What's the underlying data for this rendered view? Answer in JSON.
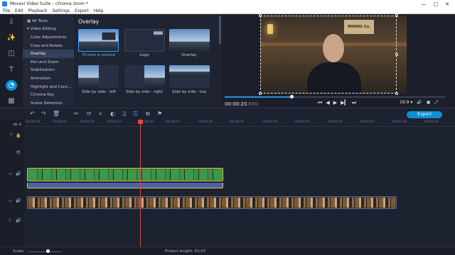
{
  "window": {
    "title": "Movavi Video Suite – chroma zoom *",
    "min": "—",
    "max": "□",
    "close": "✕"
  },
  "menu": [
    "File",
    "Edit",
    "Playback",
    "Settings",
    "Export",
    "Help"
  ],
  "left_rail": [
    {
      "icon": "import-icon",
      "glyph": "⇩"
    },
    {
      "icon": "magic-wand-icon",
      "glyph": "✨"
    },
    {
      "icon": "transitions-icon",
      "glyph": "◫"
    },
    {
      "icon": "titles-icon",
      "glyph": "T"
    },
    {
      "icon": "stickers-icon",
      "glyph": "◔"
    },
    {
      "icon": "more-tools-icon",
      "glyph": "▦"
    }
  ],
  "tools": {
    "items": [
      {
        "label": "All Tools",
        "sub": false
      },
      {
        "label": "Video Editing",
        "sub": false
      },
      {
        "label": "Color Adjustments",
        "sub": true
      },
      {
        "label": "Crop and Rotate",
        "sub": true
      },
      {
        "label": "Overlay",
        "sub": true,
        "selected": true
      },
      {
        "label": "Pan and Zoom",
        "sub": true
      },
      {
        "label": "Stabilization",
        "sub": true
      },
      {
        "label": "Animation",
        "sub": true
      },
      {
        "label": "Highlight and Conc...",
        "sub": true
      },
      {
        "label": "Chroma Key",
        "sub": true
      },
      {
        "label": "Scene Detection",
        "sub": true
      }
    ]
  },
  "overlay_panel": {
    "title": "Overlay",
    "options": [
      {
        "label": "Picture in picture",
        "selected": true
      },
      {
        "label": "Logo"
      },
      {
        "label": "Overlay"
      },
      {
        "label": "Side by side - left"
      },
      {
        "label": "Side by side - right"
      },
      {
        "label": "Side by side - top"
      }
    ]
  },
  "preview": {
    "sign_text": "MINING Co.",
    "time_main": "00:00:20",
    "time_frac": ".650",
    "progress": 0.3,
    "aspect": "16:9 ▾",
    "controls": [
      "⏮",
      "◀",
      "▶",
      "▶▎",
      "⏭"
    ],
    "icons": [
      "🔊",
      "▣",
      "⤢"
    ]
  },
  "export_label": "Export",
  "ruler_ticks": [
    "00:00:00",
    "00:00:05",
    "00:00:10",
    "00:00:15",
    "00:00:20",
    "00:00:25",
    "00:00:30",
    "00:00:35",
    "00:00:40",
    "00:00:45",
    "00:00:50",
    "00:00:55",
    "00:01:00",
    "00:01:05"
  ],
  "status": {
    "scale": "Scale:",
    "project_length": "Project length:  01:07"
  }
}
